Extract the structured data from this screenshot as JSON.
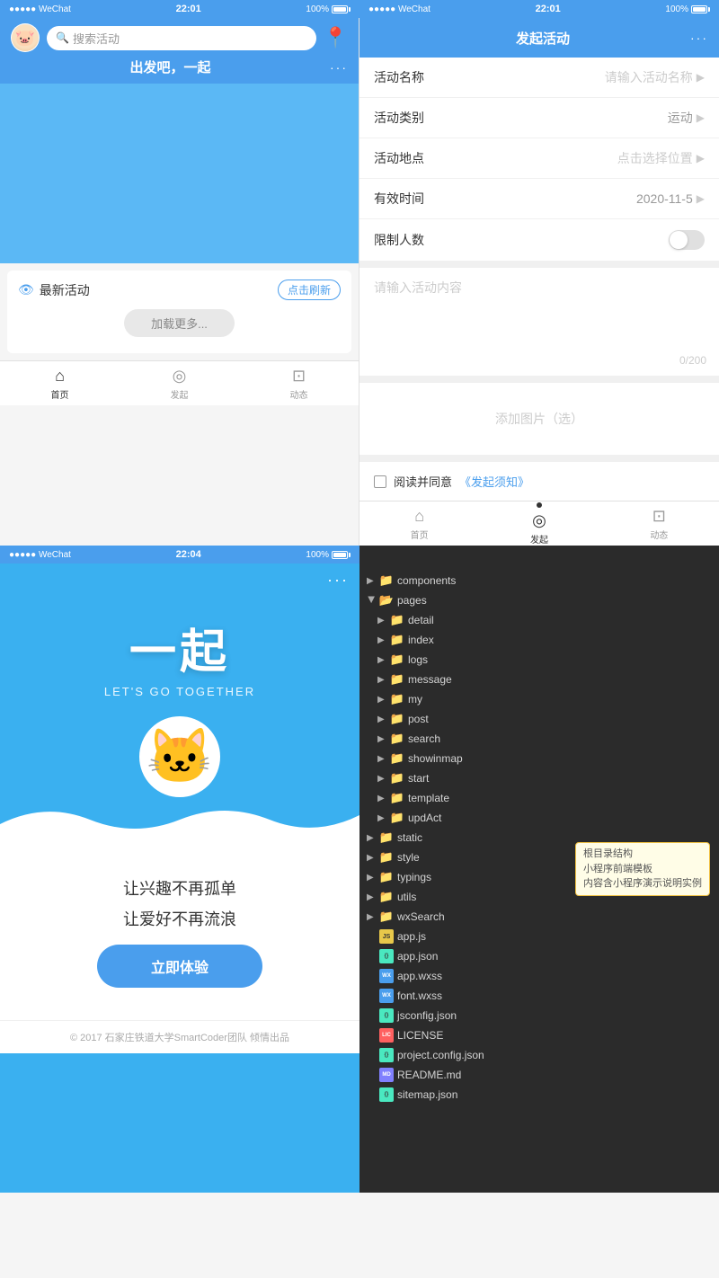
{
  "left_top": {
    "status": {
      "signal": "●●●●● WeChat",
      "time": "22:01",
      "battery": "100%"
    },
    "header": {
      "title": "出发吧，一起",
      "dots": "···"
    },
    "search_placeholder": "搜索活动",
    "latest_section": {
      "title": "最新活动",
      "refresh_btn": "点击刷新"
    },
    "load_more": "加载更多...",
    "nav": [
      {
        "label": "首页",
        "icon": "⌂",
        "active": true
      },
      {
        "label": "发起",
        "icon": "◉",
        "active": false
      },
      {
        "label": "动态",
        "icon": "◫",
        "active": false
      }
    ]
  },
  "right_top": {
    "status": {
      "signal": "●●●●● WeChat",
      "time": "22:01",
      "battery": "100%"
    },
    "header": {
      "title": "发起活动",
      "dots": "···"
    },
    "form": {
      "name_label": "活动名称",
      "name_placeholder": "请输入活动名称",
      "category_label": "活动类别",
      "category_value": "运动",
      "location_label": "活动地点",
      "location_placeholder": "点击选择位置",
      "time_label": "有效时间",
      "time_value": "2020-11-5",
      "limit_label": "限制人数",
      "content_placeholder": "请输入活动内容",
      "char_count": "0/200",
      "image_label": "添加图片（选）",
      "agreement_text": "阅读并同意",
      "agreement_link": "《发起须知》"
    },
    "nav": [
      {
        "label": "首页",
        "icon": "⌂",
        "active": false
      },
      {
        "label": "发起",
        "icon": "◉",
        "active": true
      },
      {
        "label": "动态",
        "icon": "◫",
        "active": false
      }
    ]
  },
  "left_bottom": {
    "status": {
      "signal": "●●●●● WeChat",
      "time": "22:04",
      "battery": "100%"
    },
    "dots": "···",
    "hero_main": "一起",
    "hero_sub": "LET'S GO TOGETHER",
    "slogan1": "让兴趣不再孤单",
    "slogan2": "让爱好不再流浪",
    "cta_btn": "立即体验",
    "footer": "© 2017 石家庄铁道大学SmartCoder团队 倾情出品"
  },
  "right_bottom": {
    "file_tree": {
      "items": [
        {
          "level": 0,
          "type": "folder",
          "name": "components",
          "color": "yellow",
          "open": false
        },
        {
          "level": 0,
          "type": "folder",
          "name": "pages",
          "color": "orange",
          "open": true
        },
        {
          "level": 1,
          "type": "folder",
          "name": "detail",
          "color": "blue",
          "open": false
        },
        {
          "level": 1,
          "type": "folder",
          "name": "index",
          "color": "blue",
          "open": false
        },
        {
          "level": 1,
          "type": "folder",
          "name": "logs",
          "color": "yellow",
          "open": false
        },
        {
          "level": 1,
          "type": "folder",
          "name": "message",
          "color": "blue",
          "open": false
        },
        {
          "level": 1,
          "type": "folder",
          "name": "my",
          "color": "blue",
          "open": false
        },
        {
          "level": 1,
          "type": "folder",
          "name": "post",
          "color": "blue",
          "open": false
        },
        {
          "level": 1,
          "type": "folder",
          "name": "search",
          "color": "blue",
          "open": false
        },
        {
          "level": 1,
          "type": "folder",
          "name": "showinmap",
          "color": "blue",
          "open": false
        },
        {
          "level": 1,
          "type": "folder",
          "name": "start",
          "color": "blue",
          "open": false
        },
        {
          "level": 1,
          "type": "folder",
          "name": "template",
          "color": "red",
          "open": false
        },
        {
          "level": 1,
          "type": "folder",
          "name": "updAct",
          "color": "blue",
          "open": false
        },
        {
          "level": 0,
          "type": "folder",
          "name": "static",
          "color": "blue",
          "open": false
        },
        {
          "level": 0,
          "type": "folder",
          "name": "style",
          "color": "blue",
          "open": false
        },
        {
          "level": 0,
          "type": "folder",
          "name": "typings",
          "color": "blue",
          "open": false
        },
        {
          "level": 0,
          "type": "folder",
          "name": "utils",
          "color": "blue",
          "open": false
        },
        {
          "level": 0,
          "type": "folder",
          "name": "wxSearch",
          "color": "blue",
          "open": false
        },
        {
          "level": 0,
          "type": "file",
          "name": "app.js",
          "ext": "js"
        },
        {
          "level": 0,
          "type": "file",
          "name": "app.json",
          "ext": "json"
        },
        {
          "level": 0,
          "type": "file",
          "name": "app.wxss",
          "ext": "wxss"
        },
        {
          "level": 0,
          "type": "file",
          "name": "font.wxss",
          "ext": "wxss"
        },
        {
          "level": 0,
          "type": "file",
          "name": "jsconfig.json",
          "ext": "json"
        },
        {
          "level": 0,
          "type": "file",
          "name": "LICENSE",
          "ext": "license"
        },
        {
          "level": 0,
          "type": "file",
          "name": "project.config.json",
          "ext": "json"
        },
        {
          "level": 0,
          "type": "file",
          "name": "README.md",
          "ext": "md"
        },
        {
          "level": 0,
          "type": "file",
          "name": "sitemap.json",
          "ext": "json"
        }
      ],
      "callout_line1": "根目录结构",
      "callout_line2": "小程序前端模板",
      "callout_line3": "内容含小程序演示说明实例"
    }
  }
}
